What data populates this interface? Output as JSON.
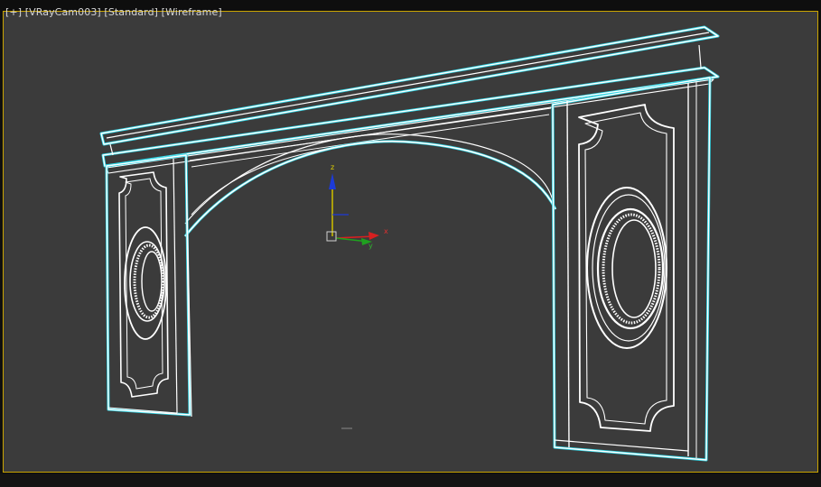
{
  "viewport": {
    "menu_plus": "[+]",
    "camera": "[VRayCam003]",
    "shading_style": "[Standard]",
    "display_mode": "[Wireframe]"
  },
  "gizmo": {
    "z_label": "z",
    "x_label": "x",
    "y_label": "y"
  },
  "colors": {
    "viewport_bg": "#3b3b3b",
    "active_border": "#c9a400",
    "wire_selected": "#ffffff",
    "wire_edge": "#2fd6e6"
  }
}
